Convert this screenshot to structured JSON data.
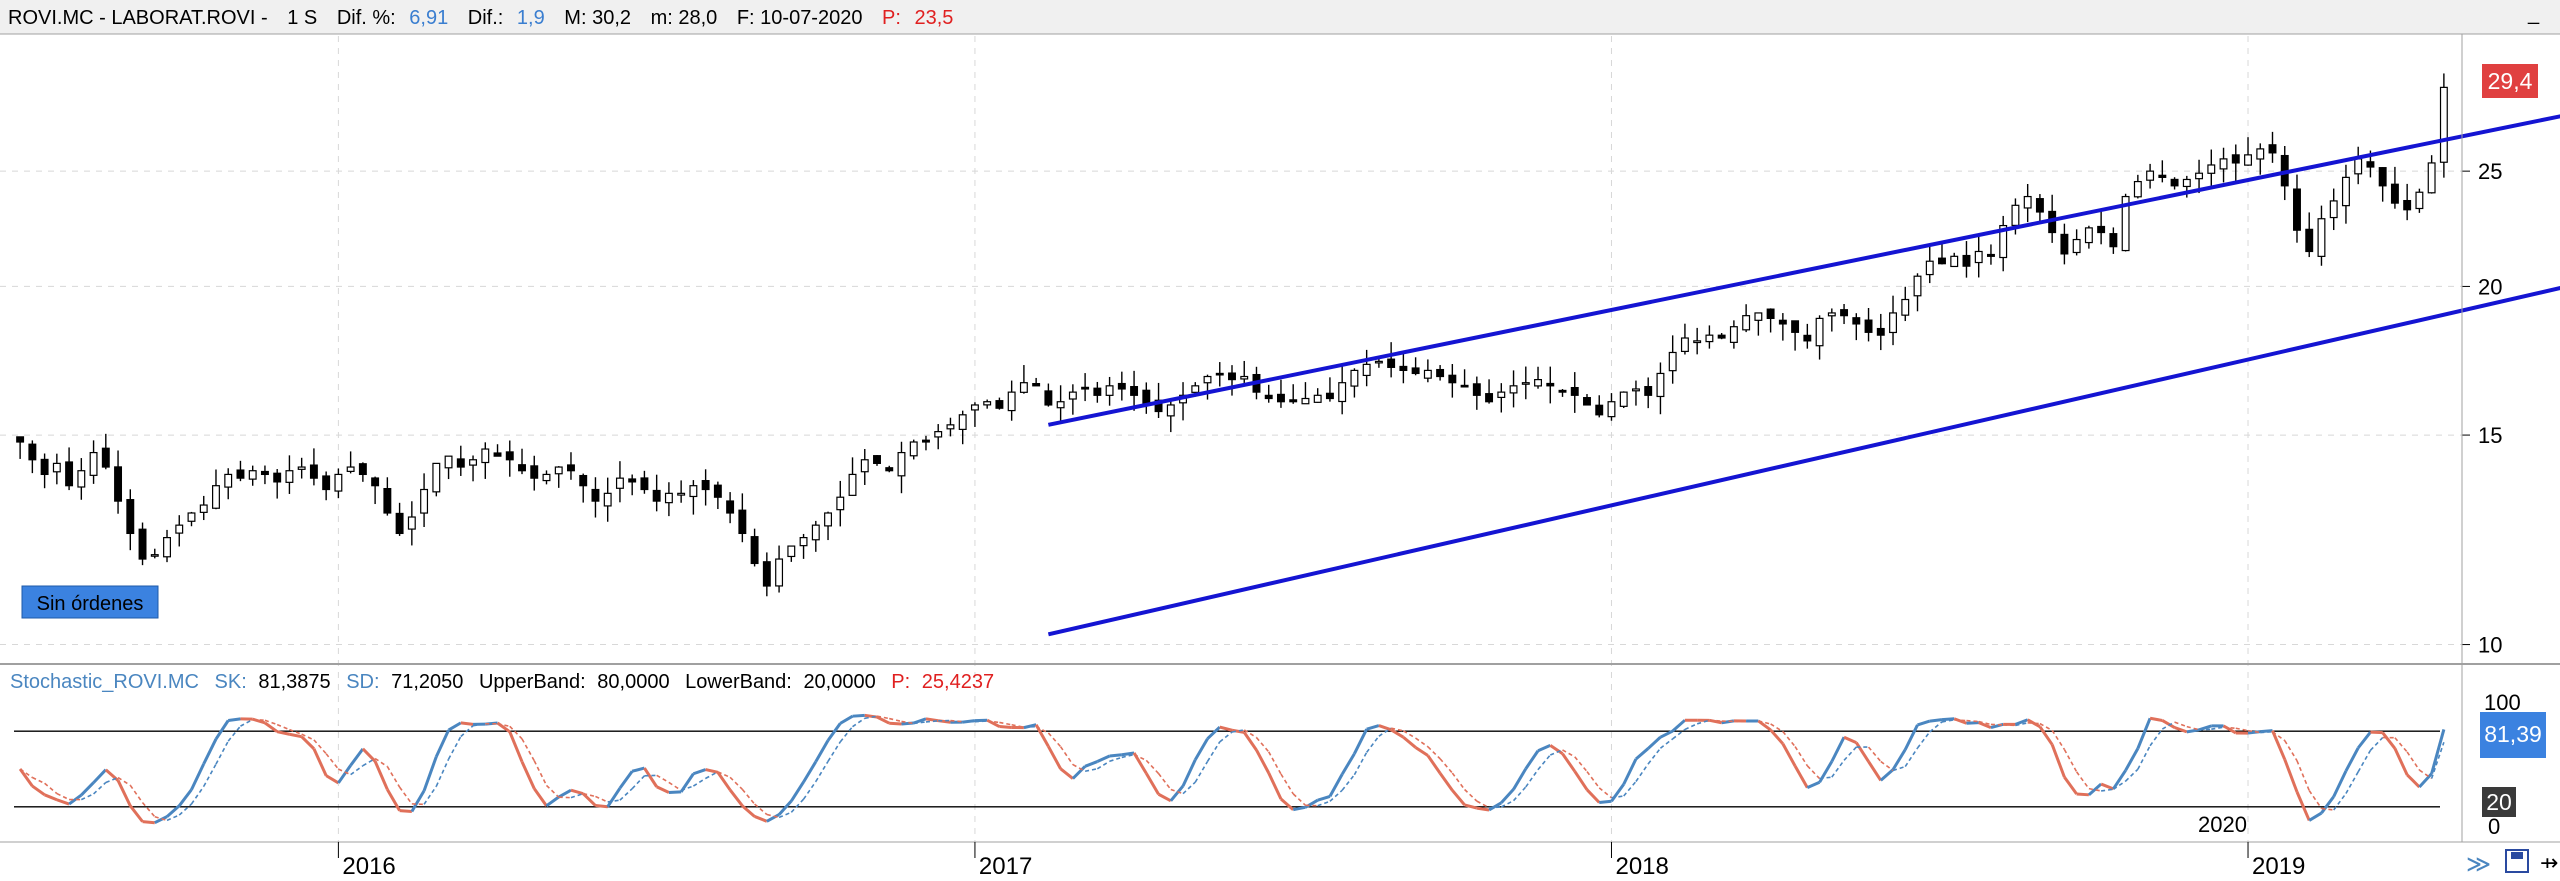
{
  "header": {
    "symbol": "ROVI.MC - LABORAT.ROVI -",
    "period": "1 S",
    "dif_pct_label": "Dif. %:",
    "dif_pct_value": "6,91",
    "dif_label": "Dif.:",
    "dif_value": "1,9",
    "max_label": "M: 30,2",
    "min_label": "m: 28,0",
    "date_label": "F: 10-07-2020",
    "price_label": "P:",
    "price_value": "23,5"
  },
  "window_controls": {
    "minimize": "_"
  },
  "orders_badge": "Sin órdenes",
  "last_price_badge": "29,4",
  "stochastic": {
    "name": "Stochastic_ROVI.MC",
    "sk_label": "SK:",
    "sk_value": "81,3875",
    "sd_label": "SD:",
    "sd_value": "71,2050",
    "upper_label": "UpperBand:",
    "upper_value": "80,0000",
    "lower_label": "LowerBand:",
    "lower_value": "20,0000",
    "p_label": "P:",
    "p_value": "25,4237",
    "badge_value": "81,39",
    "badge_lower": "20",
    "axis_top": "100",
    "axis_bottom": "0",
    "year_marker": "2020"
  },
  "colors": {
    "trendline": "#1414d2",
    "candle": "#000000",
    "stoch_up": "#4a86c0",
    "stoch_down": "#e0705a",
    "dif_value": "#3a7ed0",
    "price_value": "#e02020",
    "badge_red": "#e04040",
    "badge_blue": "#3b82e0",
    "badge_dark": "#3a3a3a"
  },
  "chart_data": [
    {
      "type": "candlestick",
      "title": "ROVI.MC - LABORAT.ROVI",
      "x_start_date": "2015-07",
      "x_end_date": "2020-07",
      "yscale": "log",
      "ylim": [
        9.8,
        31
      ],
      "y_ticks": [
        10,
        15,
        20,
        25
      ],
      "x_ticks": [
        "2016",
        "2017",
        "2018",
        "2019",
        "2020"
      ],
      "grid": true,
      "close_series": [
        14.8,
        14.3,
        13.9,
        14.2,
        13.6,
        14.0,
        14.5,
        14.1,
        13.2,
        12.4,
        11.8,
        11.9,
        12.3,
        12.6,
        12.9,
        13.1,
        13.6,
        13.9,
        13.8,
        14.0,
        13.9,
        13.7,
        14.0,
        14.1,
        13.8,
        13.5,
        13.9,
        14.1,
        13.9,
        13.6,
        12.9,
        12.4,
        12.8,
        13.5,
        14.2,
        14.4,
        14.1,
        14.3,
        14.6,
        14.4,
        14.3,
        14.0,
        13.8,
        13.9,
        14.1,
        14.0,
        13.6,
        13.2,
        13.4,
        13.8,
        13.7,
        13.5,
        13.2,
        13.4,
        13.4,
        13.6,
        13.5,
        13.3,
        12.9,
        12.4,
        11.7,
        11.2,
        11.8,
        12.1,
        12.3,
        12.6,
        12.9,
        13.3,
        13.9,
        14.3,
        14.2,
        14.0,
        14.5,
        14.8,
        14.8,
        15.1,
        15.3,
        15.6,
        15.9,
        16.0,
        15.8,
        16.3,
        16.6,
        16.5,
        15.9,
        16.0,
        16.3,
        16.4,
        16.2,
        16.5,
        16.4,
        16.2,
        15.9,
        15.7,
        15.9,
        16.2,
        16.5,
        16.8,
        16.9,
        16.7,
        16.8,
        16.3,
        16.1,
        16.0,
        16.0,
        16.1,
        16.2,
        16.1,
        16.6,
        17.0,
        17.2,
        17.3,
        17.1,
        17.0,
        16.9,
        17.0,
        16.8,
        16.6,
        16.5,
        16.2,
        16.0,
        16.3,
        16.5,
        16.6,
        16.7,
        16.5,
        16.3,
        16.2,
        15.9,
        15.6,
        16.0,
        16.3,
        16.4,
        16.2,
        16.9,
        17.6,
        18.1,
        18.0,
        18.2,
        18.1,
        18.5,
        18.9,
        19.0,
        18.8,
        18.6,
        18.3,
        18.0,
        18.8,
        19.0,
        18.9,
        18.6,
        18.3,
        18.2,
        19.0,
        19.5,
        20.4,
        21.0,
        20.9,
        21.2,
        20.8,
        21.4,
        21.2,
        22.5,
        23.4,
        23.8,
        23.1,
        22.2,
        21.3,
        21.9,
        22.4,
        22.2,
        21.6,
        23.8,
        24.5,
        25.0,
        24.7,
        24.3,
        24.6,
        24.9,
        25.3,
        25.6,
        25.4,
        25.8,
        26.1,
        25.9,
        24.3,
        22.3,
        21.4,
        22.8,
        23.6,
        24.7,
        25.6,
        25.2,
        24.3,
        23.5,
        23.2,
        24.0,
        25.4,
        29.4
      ]
    },
    {
      "type": "line",
      "title": "Stochastic_ROVI.MC",
      "ylim": [
        0,
        100
      ],
      "bands": [
        20,
        80
      ],
      "series": [
        {
          "name": "SK",
          "last": 81.3875
        },
        {
          "name": "SD",
          "last": 71.205
        }
      ]
    }
  ]
}
